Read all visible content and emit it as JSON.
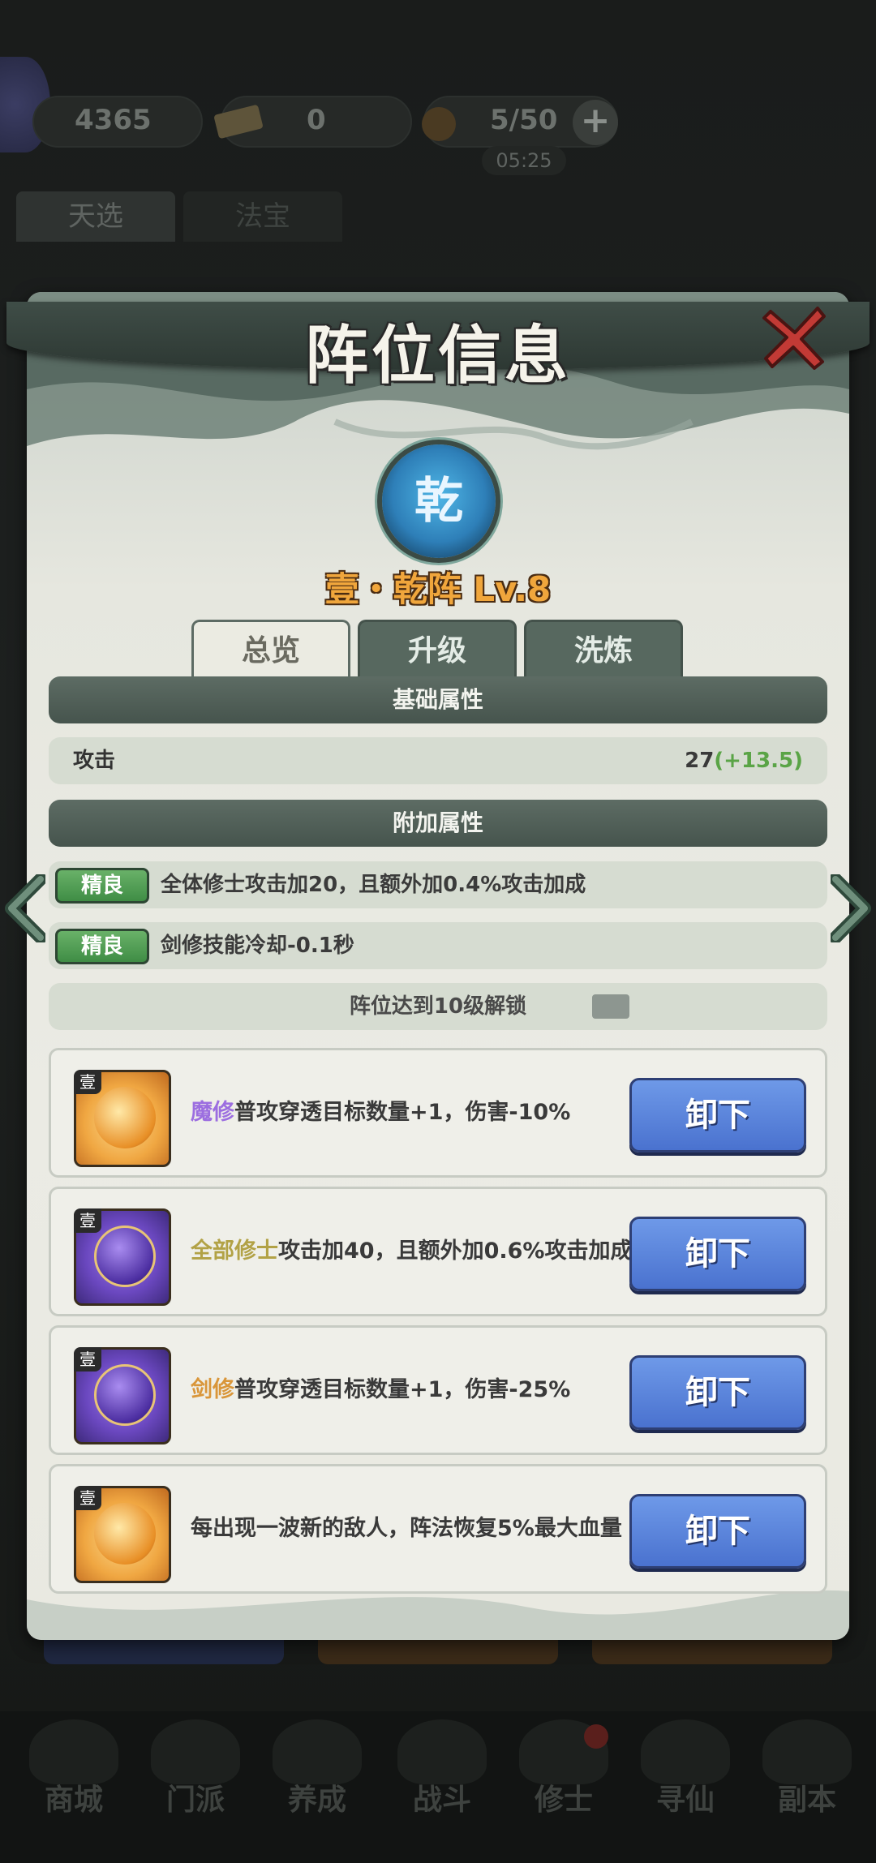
{
  "resources": {
    "coins": "4365",
    "tickets": "0",
    "energy": "5/50",
    "energy_timer": "05:25"
  },
  "background_tabs": [
    "天选",
    "法宝"
  ],
  "bottom_nav": [
    "商城",
    "门派",
    "养成",
    "战斗",
    "修士",
    "寻仙",
    "副本"
  ],
  "panel": {
    "title": "阵位信息",
    "emblem_char": "乾",
    "formation_name": "壹・乾阵 Lv.8",
    "tabs": [
      "总览",
      "升级",
      "洗炼"
    ],
    "base_header": "基础属性",
    "attack_label": "攻击",
    "attack_value": "27",
    "attack_bonus": "(+13.5)",
    "extra_header": "附加属性",
    "extra_rows": [
      {
        "badge": "精良",
        "text": "全体修士攻击加20，且额外加0.4%攻击加成"
      },
      {
        "badge": "精良",
        "text": "剑修技能冷却-0.1秒"
      }
    ],
    "lock_text": "阵位达到10级解锁",
    "cards": [
      {
        "tier": "壹",
        "highlight": "魔修",
        "text": "普攻穿透目标数量+1，伤害-10%",
        "button": "卸下"
      },
      {
        "tier": "壹",
        "highlight": "全部修士",
        "text": "攻击加40，且额外加0.6%攻击加成",
        "button": "卸下"
      },
      {
        "tier": "壹",
        "highlight": "剑修",
        "text": "普攻穿透目标数量+1，伤害-25%",
        "button": "卸下"
      },
      {
        "tier": "壹",
        "highlight": "",
        "text": "每出现一波新的敌人，阵法恢复5%最大血量",
        "button": "卸下"
      }
    ]
  },
  "colors": {
    "panel_bg": "#ebebe4",
    "section_header": "#4f5e56",
    "badge_green": "#4f9e53",
    "button_blue": "#5a82da",
    "formation_name": "#f0a63c",
    "bonus_green": "#5aa446",
    "highlight_purple": "#9c6ee0",
    "highlight_olive": "#b2a246",
    "highlight_orange": "#d9963a"
  },
  "icons": [
    "gamepad-icon",
    "ticket-icon",
    "bomb-icon",
    "plus-icon",
    "close-icon",
    "formation-emblem-icon",
    "lock-icon",
    "arrow-left-icon",
    "arrow-right-icon",
    "gold-orb-icon",
    "purple-orb-icon"
  ]
}
